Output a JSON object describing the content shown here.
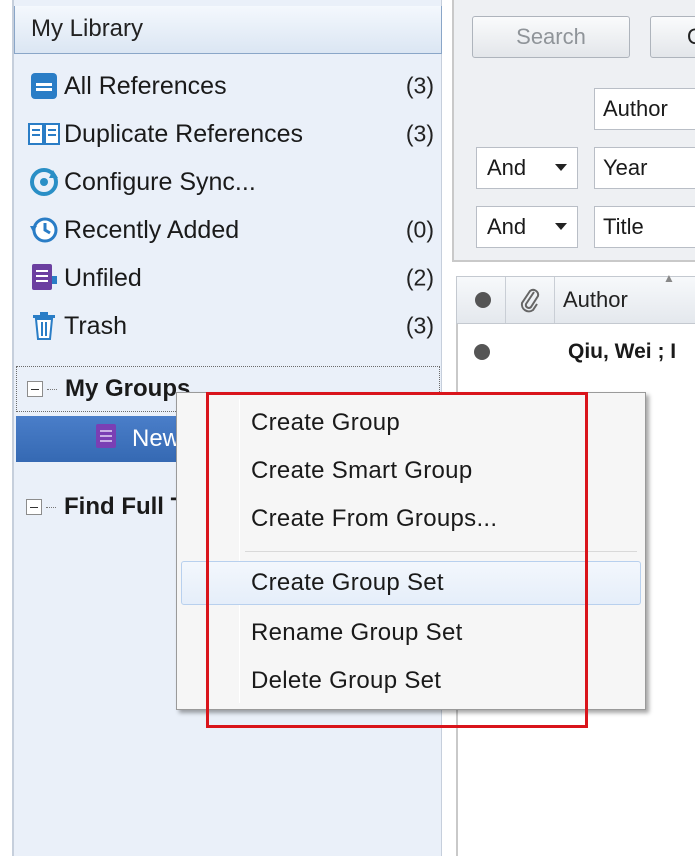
{
  "library": {
    "title": "My Library",
    "items": [
      {
        "label": "All References",
        "count": "(3)",
        "icon": "all-references-icon"
      },
      {
        "label": "Duplicate References",
        "count": "(3)",
        "icon": "duplicate-references-icon"
      },
      {
        "label": "Configure Sync...",
        "count": "",
        "icon": "sync-icon"
      },
      {
        "label": "Recently Added",
        "count": "(0)",
        "icon": "recently-added-icon"
      },
      {
        "label": "Unfiled",
        "count": "(2)",
        "icon": "unfiled-icon"
      },
      {
        "label": "Trash",
        "count": "(3)",
        "icon": "trash-icon"
      }
    ],
    "groups": {
      "my_groups": "My Groups",
      "new_group": "New",
      "find_full_text": "Find Full T"
    }
  },
  "search": {
    "search_label": "Search",
    "options_label": "O",
    "rows": [
      {
        "operator": "",
        "field": "Author"
      },
      {
        "operator": "And",
        "field": "Year"
      },
      {
        "operator": "And",
        "field": "Title"
      }
    ]
  },
  "reference_list": {
    "columns": {
      "author": "Author"
    },
    "rows": [
      {
        "author": "Qiu, Wei ; I"
      }
    ]
  },
  "context_menu": {
    "items": [
      "Create Group",
      "Create Smart Group",
      "Create From Groups...",
      "Create Group Set",
      "Rename Group Set",
      "Delete Group Set"
    ],
    "hovered_item": "Create Group Set"
  },
  "colors": {
    "highlight_box": "#d9141b",
    "selection": "#3d72bd",
    "accent_blue": "#2a7dc6",
    "group_purple": "#6b3fa0"
  }
}
